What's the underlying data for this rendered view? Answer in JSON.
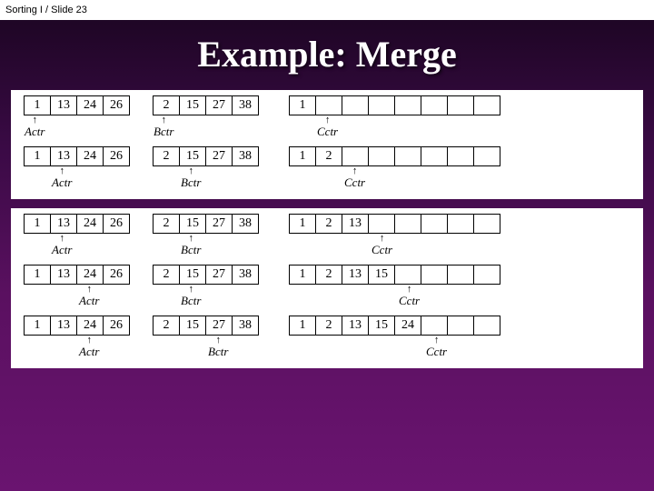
{
  "header": {
    "text": "Sorting I  / Slide 23"
  },
  "title": "Example: Merge",
  "labels": {
    "actr": "Actr",
    "bctr": "Bctr",
    "cctr": "Cctr"
  },
  "arrow_up": "↑",
  "rows": [
    {
      "A": [
        "1",
        "13",
        "24",
        "26"
      ],
      "B": [
        "2",
        "15",
        "27",
        "38"
      ],
      "C": [
        "1",
        "",
        "",
        "",
        "",
        "",
        "",
        ""
      ],
      "aPtr": 0,
      "bPtr": 0,
      "cPtr": 1
    },
    {
      "A": [
        "1",
        "13",
        "24",
        "26"
      ],
      "B": [
        "2",
        "15",
        "27",
        "38"
      ],
      "C": [
        "1",
        "2",
        "",
        "",
        "",
        "",
        "",
        ""
      ],
      "aPtr": 1,
      "bPtr": 1,
      "cPtr": 2
    },
    {
      "A": [
        "1",
        "13",
        "24",
        "26"
      ],
      "B": [
        "2",
        "15",
        "27",
        "38"
      ],
      "C": [
        "1",
        "2",
        "13",
        "",
        "",
        "",
        "",
        ""
      ],
      "aPtr": 1,
      "bPtr": 1,
      "cPtr": 3
    },
    {
      "A": [
        "1",
        "13",
        "24",
        "26"
      ],
      "B": [
        "2",
        "15",
        "27",
        "38"
      ],
      "C": [
        "1",
        "2",
        "13",
        "15",
        "",
        "",
        "",
        ""
      ],
      "aPtr": 2,
      "bPtr": 1,
      "cPtr": 4
    },
    {
      "A": [
        "1",
        "13",
        "24",
        "26"
      ],
      "B": [
        "2",
        "15",
        "27",
        "38"
      ],
      "C": [
        "1",
        "2",
        "13",
        "15",
        "24",
        "",
        "",
        ""
      ],
      "aPtr": 2,
      "bPtr": 2,
      "cPtr": 5
    }
  ]
}
